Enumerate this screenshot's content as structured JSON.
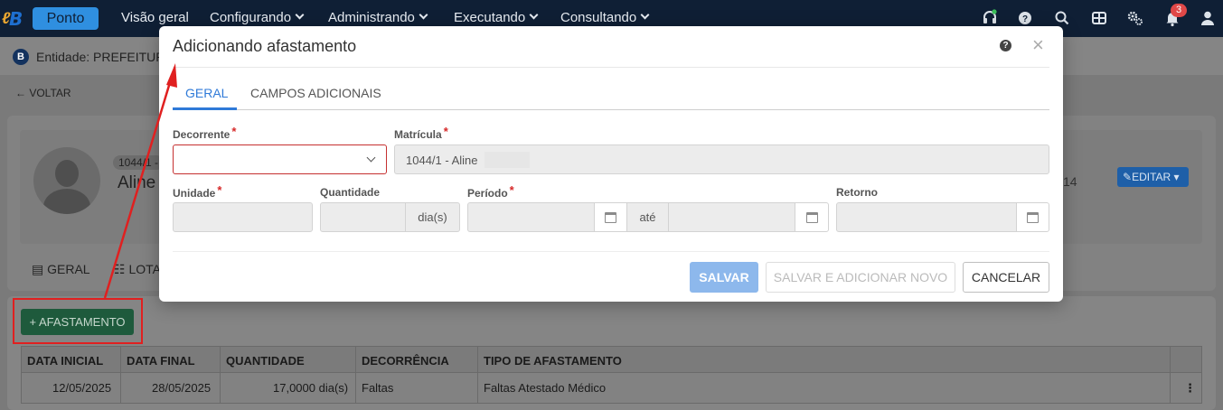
{
  "topbar": {
    "module": "Ponto",
    "nav": [
      {
        "label": "Visão geral",
        "has_menu": false
      },
      {
        "label": "Configurando",
        "has_menu": true
      },
      {
        "label": "Administrando",
        "has_menu": true
      },
      {
        "label": "Executando",
        "has_menu": true
      },
      {
        "label": "Consultando",
        "has_menu": true
      }
    ],
    "icons": [
      "headset-icon",
      "help-icon",
      "search-icon",
      "apps-grid-icon",
      "settings-gears-icon",
      "bell-icon",
      "user-icon"
    ],
    "notifications_count": "3"
  },
  "entity": {
    "text": "Entidade: PREFEITUR"
  },
  "back": {
    "label": "VOLTAR"
  },
  "profile": {
    "chip": "1044/1 -",
    "name": "Aline",
    "right_text": "14",
    "edit_label": "EDITAR"
  },
  "background_tabs": [
    {
      "label": "GERAL"
    },
    {
      "label": "LOTA"
    }
  ],
  "list": {
    "add_label": "AFASTAMENTO",
    "columns": [
      "DATA INICIAL",
      "DATA FINAL",
      "QUANTIDADE",
      "DECORRÊNCIA",
      "TIPO DE AFASTAMENTO"
    ],
    "rows": [
      {
        "data_inicial": "12/05/2025",
        "data_final": "28/05/2025",
        "quantidade": "17,0000 dia(s)",
        "decorrencia": "Faltas",
        "tipo": "Faltas Atestado Médico",
        "menu": "⋮"
      }
    ]
  },
  "modal": {
    "title": "Adicionando afastamento",
    "tabs": [
      {
        "label": "GERAL",
        "active": true
      },
      {
        "label": "CAMPOS ADICIONAIS",
        "active": false
      }
    ],
    "fields": {
      "decorrente": {
        "label": "Decorrente",
        "required": true,
        "value": ""
      },
      "matricula": {
        "label": "Matrícula",
        "required": true,
        "value": "1044/1 - Aline"
      },
      "unidade": {
        "label": "Unidade",
        "required": true,
        "value": ""
      },
      "quantidade": {
        "label": "Quantidade",
        "required": false,
        "value": "",
        "suffix": "dia(s)"
      },
      "periodo": {
        "label": "Período",
        "required": true,
        "start": "",
        "end": "",
        "separator": "até"
      },
      "retorno": {
        "label": "Retorno",
        "required": false,
        "value": ""
      }
    },
    "buttons": {
      "save": "SALVAR",
      "save_new": "SALVAR E ADICIONAR NOVO",
      "cancel": "CANCELAR"
    }
  },
  "colors": {
    "navbar": "#0f1f35",
    "accent": "#2f7ad8",
    "required": "#d62828",
    "annotation": "#e02020"
  }
}
